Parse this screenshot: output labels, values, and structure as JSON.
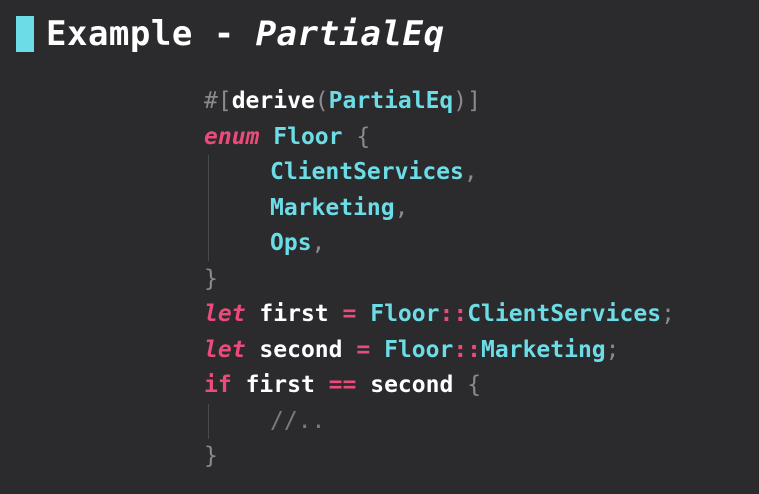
{
  "title": {
    "prefix": "Example - ",
    "emphasis": "PartialEq",
    "accent_color": "#6cdde6"
  },
  "code": {
    "attr_hash": "#[",
    "attr_derive": "derive",
    "attr_open": "(",
    "attr_type": "PartialEq",
    "attr_close": ")]",
    "kw_enum": "enum",
    "enum_name": "Floor",
    "brace_open": "{",
    "brace_close": "}",
    "variant_1": "ClientServices",
    "variant_2": "Marketing",
    "variant_3": "Ops",
    "comma": ",",
    "kw_let": "let",
    "var_first": "first",
    "var_second": "second",
    "op_assign": "=",
    "path_sep": "::",
    "semicolon": ";",
    "kw_if": "if",
    "op_eq": "==",
    "comment": "//.."
  },
  "colors": {
    "background": "#2b2b2d",
    "keyword": "#ec4a7b",
    "type": "#6cdde6",
    "identifier": "#ffffff",
    "punctuation": "#8a8a8e"
  }
}
